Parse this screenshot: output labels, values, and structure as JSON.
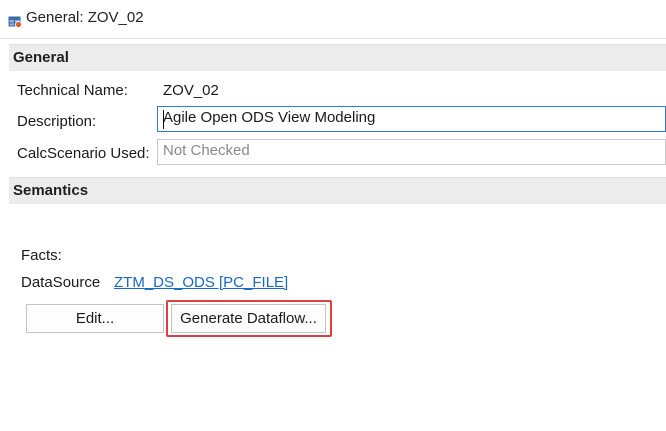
{
  "window": {
    "icon": "view-model-icon",
    "title": "General: ZOV_02"
  },
  "general": {
    "header": "General",
    "technical_name_label": "Technical Name:",
    "technical_name_value": "ZOV_02",
    "description_label": "Description:",
    "description_value": "Agile Open ODS View Modeling",
    "calcscenario_label": "CalcScenario Used:",
    "calcscenario_value": "Not Checked"
  },
  "semantics": {
    "header": "Semantics",
    "facts_label": "Facts:",
    "datasource_label": "DataSource",
    "datasource_link": "ZTM_DS_ODS [PC_FILE]",
    "edit_button": "Edit...",
    "generate_button": "Generate Dataflow..."
  },
  "colors": {
    "highlight": "#d9423f",
    "link": "#1769c4",
    "active_border": "#2e7cd6"
  }
}
